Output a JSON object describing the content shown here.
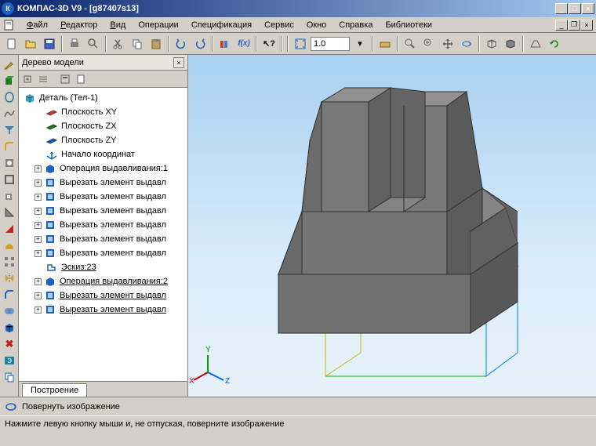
{
  "title": "КОМПАС-3D V9 - [g87407s13]",
  "menu": {
    "file": "Файл",
    "editor": "Редактор",
    "view": "Вид",
    "operations": "Операции",
    "specification": "Спецификация",
    "service": "Сервис",
    "window": "Окно",
    "help": "Справка",
    "libraries": "Библиотеки"
  },
  "toolbar2": {
    "scale_value": "1.0",
    "fx_label": "f(x)"
  },
  "tree": {
    "title": "Дерево модели",
    "root": "Деталь (Тел-1)",
    "plane_xy": "Плоскость XY",
    "plane_zx": "Плоскость ZX",
    "plane_zy": "Плоскость ZY",
    "origin": "Начало координат",
    "extrude1": "Операция выдавливания:1",
    "cut1": "Вырезать элемент выдавл",
    "cut2": "Вырезать элемент выдавл",
    "cut3": "Вырезать элемент выдавл",
    "cut4": "Вырезать элемент выдавл",
    "cut5": "Вырезать элемент выдавл",
    "cut6": "Вырезать элемент выдавл",
    "sketch23": "Эскиз:23",
    "extrude2": "Операция выдавливания:2",
    "cut7": "Вырезать элемент выдавл",
    "cut8": "Вырезать элемент выдавл",
    "tab": "Построение"
  },
  "bottom": {
    "label": "Повернуть изображение"
  },
  "status": {
    "text": "Нажмите левую кнопку мыши и, не отпуская, поверните изображение"
  },
  "axis": {
    "x": "X",
    "y": "Y",
    "z": "Z"
  }
}
